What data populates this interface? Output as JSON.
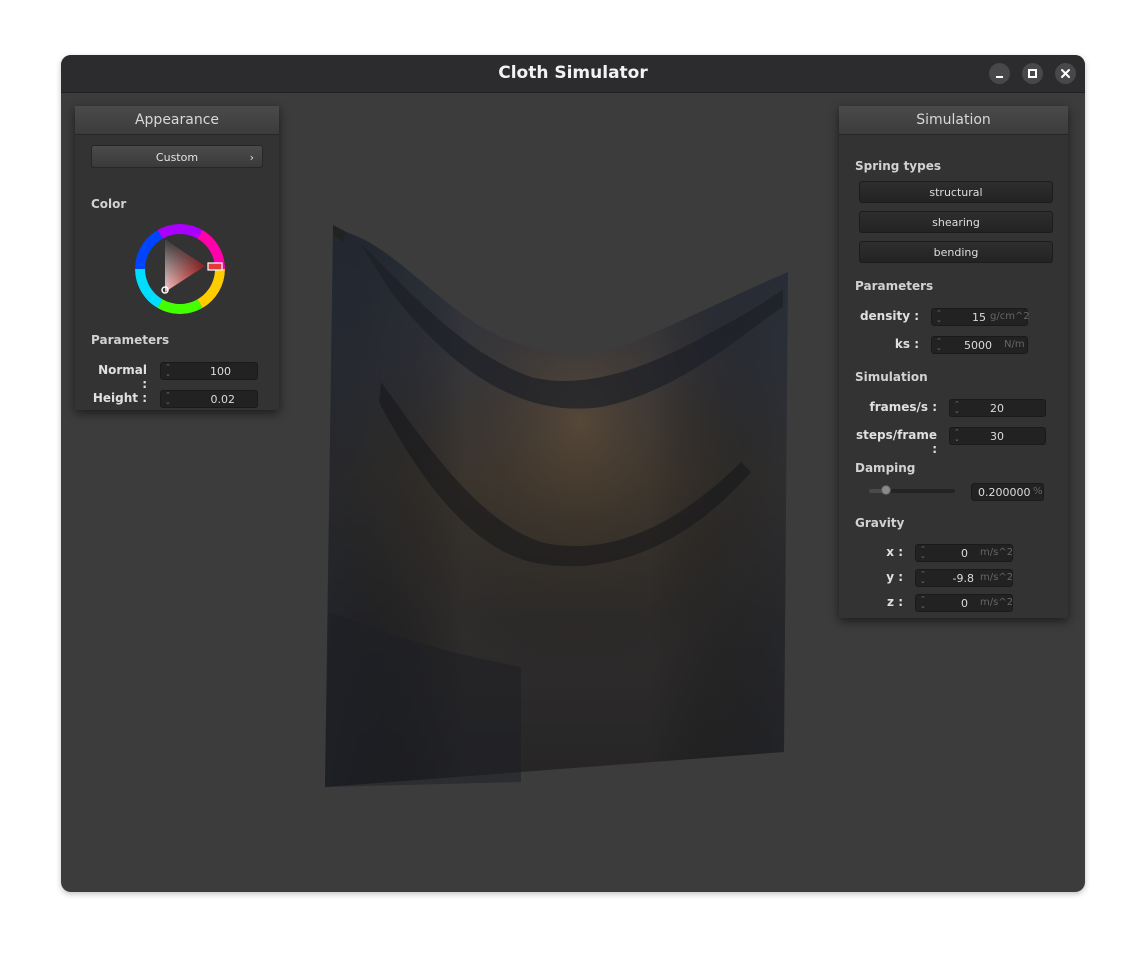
{
  "window": {
    "title": "Cloth Simulator"
  },
  "appearance": {
    "header": "Appearance",
    "shader": "Custom",
    "color_label": "Color",
    "parameters_label": "Parameters",
    "normal_label": "Normal :",
    "normal_value": "100",
    "height_label": "Height :",
    "height_value": "0.02",
    "selected_color": "#e23a3a"
  },
  "simulation": {
    "header": "Simulation",
    "spring_types_label": "Spring types",
    "springs": [
      "structural",
      "shearing",
      "bending"
    ],
    "parameters_label": "Parameters",
    "density_label": "density :",
    "density_value": "15",
    "density_unit": "g/cm^2",
    "ks_label": "ks :",
    "ks_value": "5000",
    "ks_unit": "N/m",
    "simulation_label": "Simulation",
    "fps_label": "frames/s :",
    "fps_value": "20",
    "steps_label": "steps/frame :",
    "steps_value": "30",
    "damping_label": "Damping",
    "damping_value": "0.200000",
    "damping_unit": "%",
    "damping_fraction": 0.2,
    "gravity_label": "Gravity",
    "gx_label": "x :",
    "gx_value": "0",
    "gy_label": "y :",
    "gy_value": "-9.8",
    "gz_label": "z :",
    "gz_value": "0",
    "gravity_unit": "m/s^2"
  }
}
